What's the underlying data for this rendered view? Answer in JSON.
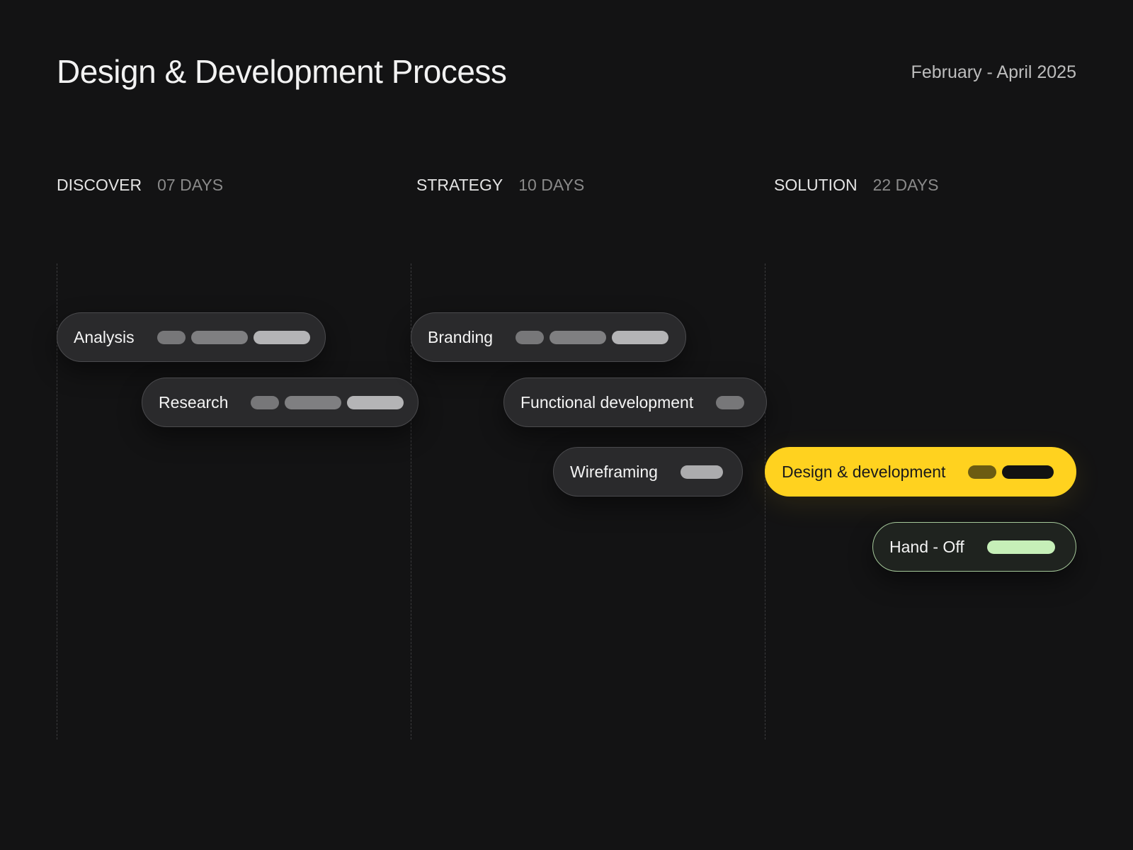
{
  "header": {
    "title": "Design & Development Process",
    "date_range": "February - April 2025"
  },
  "phases": [
    {
      "name": "DISCOVER",
      "days": "07 DAYS"
    },
    {
      "name": "STRATEGY",
      "days": "10 DAYS"
    },
    {
      "name": "SOLUTION",
      "days": "22 DAYS"
    }
  ],
  "tasks": [
    {
      "label": "Analysis",
      "phase": "DISCOVER"
    },
    {
      "label": "Research",
      "phase": "DISCOVER"
    },
    {
      "label": "Branding",
      "phase": "STRATEGY"
    },
    {
      "label": "Functional development",
      "phase": "STRATEGY"
    },
    {
      "label": "Wireframing",
      "phase": "STRATEGY"
    },
    {
      "label": "Design & development",
      "phase": "SOLUTION",
      "highlighted": true
    },
    {
      "label": "Hand - Off",
      "phase": "SOLUTION"
    }
  ],
  "colors": {
    "background": "#131314",
    "pill": "#2a2a2c",
    "highlight": "#ffd21f",
    "handoff_accent": "#c6efb8"
  }
}
